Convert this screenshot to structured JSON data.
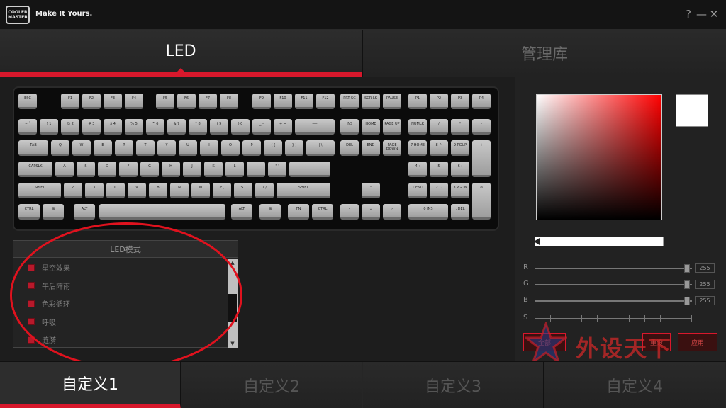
{
  "brand": {
    "logo_text": "COOLER MASTER",
    "tagline": "Make It Yours."
  },
  "window_controls": {
    "help": "?",
    "minimize": "—",
    "close": "✕"
  },
  "top_tabs": [
    {
      "label": "LED"
    },
    {
      "label": "管理库"
    }
  ],
  "keyboard": {
    "row0": [
      "ESC",
      "F1",
      "F2",
      "F3",
      "F4",
      "F5",
      "F6",
      "F7",
      "F8",
      "F9",
      "F10",
      "F11",
      "F12",
      "PRT SC",
      "SCR LK",
      "PAUSE",
      "P1",
      "P2",
      "P3",
      "P4"
    ],
    "row1": [
      "~ `",
      "! 1",
      "@ 2",
      "# 3",
      "$ 4",
      "% 5",
      "^ 6",
      "& 7",
      "* 8",
      "( 9",
      ") 0",
      "_ -",
      "+ =",
      "⟵",
      "INS",
      "HOME",
      "PAGE UP",
      "NUMLK",
      "/",
      "*",
      "-"
    ],
    "row2": [
      "TAB",
      "Q",
      "W",
      "E",
      "R",
      "T",
      "Y",
      "U",
      "I",
      "O",
      "P",
      "{ [",
      "} ]",
      "| \\",
      "DEL",
      "END",
      "PAGE DOWN",
      "7 HOME",
      "8 ⌃",
      "9 PGUP",
      "+"
    ],
    "row3": [
      "CAPSLK",
      "A",
      "S",
      "D",
      "F",
      "G",
      "H",
      "J",
      "K",
      "L",
      ": ;",
      "\" '",
      "⟵",
      "4 ‹",
      "5",
      "6 ›"
    ],
    "row4": [
      "SHIFT",
      "Z",
      "X",
      "C",
      "V",
      "B",
      "N",
      "M",
      "< ,",
      "> .",
      "? /",
      "SHIFT",
      "⌃",
      "1 END",
      "2 ⌄",
      "3 PGDN",
      "⏎"
    ],
    "row5": [
      "CTRL",
      "⊞",
      "ALT",
      "",
      "ALT",
      "⊞",
      "FN",
      "CTRL",
      "‹",
      "⌄",
      "›",
      "0 INS",
      ". DEL"
    ]
  },
  "led_mode": {
    "title": "LED模式",
    "items": [
      {
        "label": "星空效果"
      },
      {
        "label": "午后阵雨"
      },
      {
        "label": "色彩循环"
      },
      {
        "label": "呼吸"
      },
      {
        "label": "涟漪"
      }
    ]
  },
  "color_picker": {
    "selected_color": "#ffffff",
    "sliders": [
      {
        "label": "R",
        "value": "255"
      },
      {
        "label": "G",
        "value": "255"
      },
      {
        "label": "B",
        "value": "255"
      },
      {
        "label": "S",
        "value": ""
      }
    ]
  },
  "buttons": {
    "left": "全部",
    "mid": "重设",
    "right": "应用"
  },
  "watermark": {
    "text": "外设天下",
    "url": "www.wstx.com"
  },
  "profiles": [
    {
      "label": "自定义1"
    },
    {
      "label": "自定义2"
    },
    {
      "label": "自定义3"
    },
    {
      "label": "自定义4"
    }
  ],
  "colors": {
    "accent": "#d8182c",
    "background": "#1d1d1d"
  }
}
